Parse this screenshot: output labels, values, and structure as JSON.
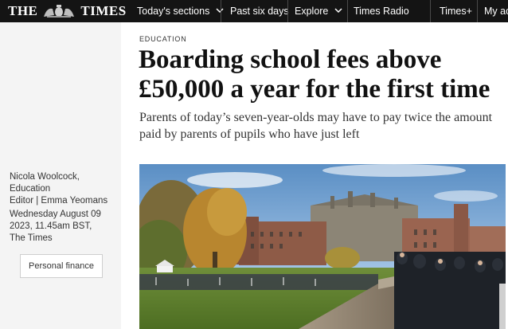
{
  "header": {
    "logo_left": "THE",
    "logo_right": "TIMES",
    "nav": [
      {
        "label": "Today's sections",
        "has_chevron": true
      },
      {
        "label": "Past six days",
        "has_chevron": false
      },
      {
        "label": "Explore",
        "has_chevron": true
      },
      {
        "label": "Times Radio",
        "has_chevron": false
      },
      {
        "label": "Times+",
        "has_chevron": false
      },
      {
        "label": "My ac",
        "has_chevron": false
      }
    ]
  },
  "article": {
    "section": "EDUCATION",
    "headline": "Boarding school fees above £50,000 a year for the first time",
    "standfirst": "Parents of today’s seven-year-olds may have to pay twice the amount paid by parents of pupils who have just left",
    "author_line_1": "Nicola Woolcock, Education",
    "author_line_2_prefix": "Editor | ",
    "author_line_2_name": "Emma Yeomans",
    "date_line_1": "Wednesday August 09",
    "date_line_2": "2023, 11.45am BST,",
    "date_line_3": "The Times",
    "tag": "Personal finance"
  },
  "colors": {
    "topbar_bg": "#141414",
    "sidebar_bg": "#f4f4f4",
    "headline": "#111111",
    "text": "#333333"
  },
  "icons": {
    "crest": "royal-coat-of-arms-icon",
    "chevron": "chevron-down-icon"
  }
}
